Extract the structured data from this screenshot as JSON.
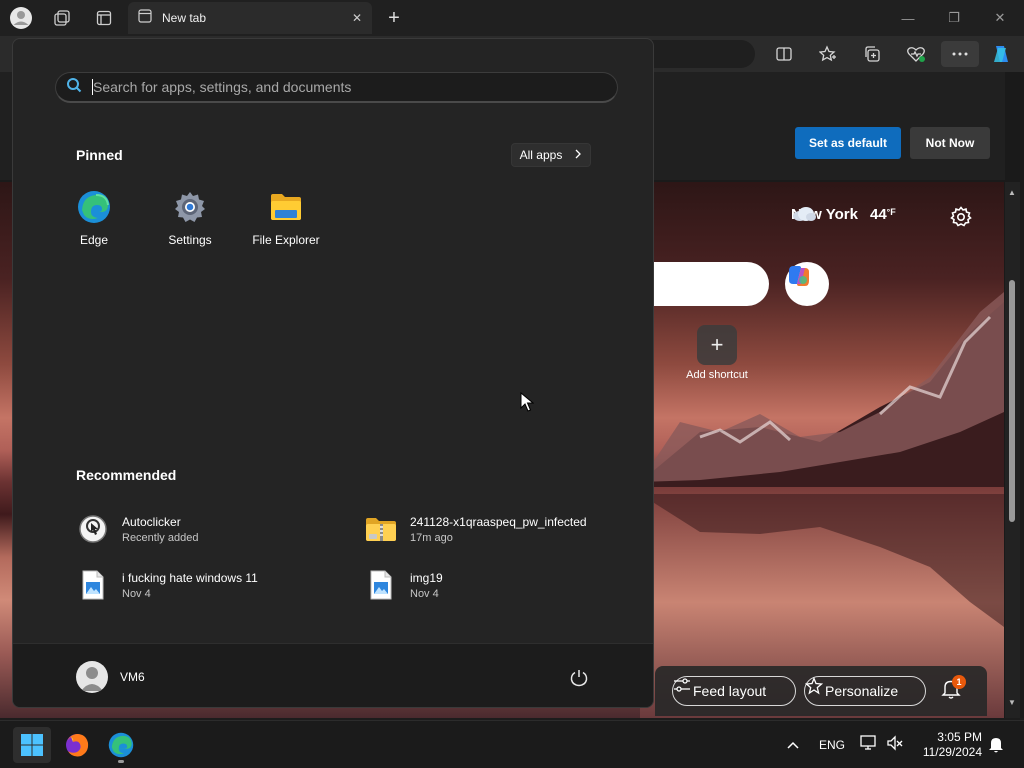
{
  "browser": {
    "tab_title": "New tab",
    "tab_close": "✕",
    "new_tab": "+",
    "window_controls": {
      "minimize": "—",
      "restore": "❐",
      "close": "✕"
    }
  },
  "banner": {
    "set_default": "Set as default",
    "not_now": "Not Now"
  },
  "newtab": {
    "city": "New York",
    "temperature": "44",
    "temp_unit": "°F",
    "add_shortcut_label": "Add shortcut",
    "add_shortcut_symbol": "+",
    "feed_layout": "Feed layout",
    "personalize": "Personalize",
    "notification_count": "1"
  },
  "start_menu": {
    "search_placeholder": "Search for apps, settings, and documents",
    "pinned_title": "Pinned",
    "all_apps_label": "All apps",
    "pinned": [
      {
        "label": "Edge",
        "icon": "edge-icon"
      },
      {
        "label": "Settings",
        "icon": "settings-icon"
      },
      {
        "label": "File Explorer",
        "icon": "file-explorer-icon"
      }
    ],
    "recommended_title": "Recommended",
    "recommended": [
      {
        "name": "Autoclicker",
        "sub": "Recently added",
        "icon": "autoclicker-icon"
      },
      {
        "name": "241128-x1qraaspeq_pw_infected",
        "sub": "17m ago",
        "icon": "zip-folder-icon"
      },
      {
        "name": "i fucking hate windows 11",
        "sub": "Nov 4",
        "icon": "image-file-icon"
      },
      {
        "name": "img19",
        "sub": "Nov 4",
        "icon": "image-file-icon"
      }
    ],
    "user_name": "VM6"
  },
  "taskbar": {
    "language": "ENG",
    "time": "3:05 PM",
    "date": "11/29/2024"
  },
  "colors": {
    "accent_blue": "#0f6cbd",
    "start_bg": "#242424",
    "taskbar_bg": "#1b1b1b",
    "badge_orange": "#e8590c"
  }
}
